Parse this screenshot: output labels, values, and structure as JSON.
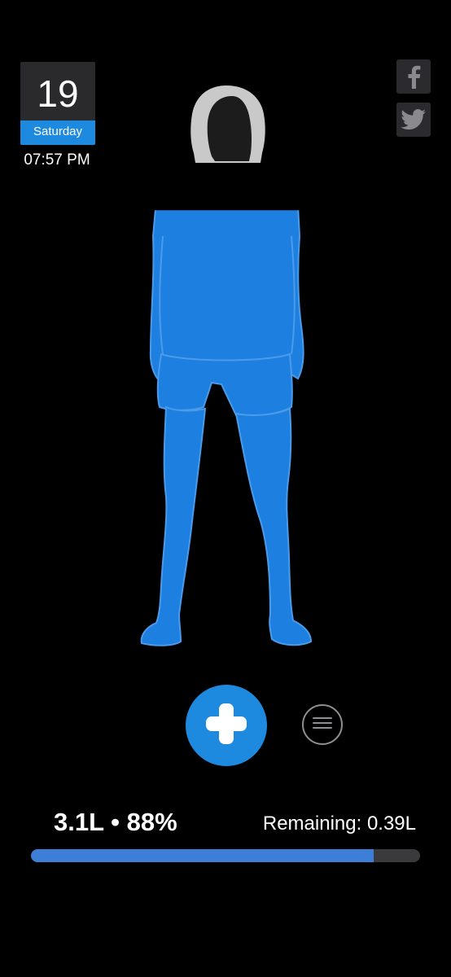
{
  "calendar": {
    "day": "19",
    "weekday": "Saturday",
    "time": "07:57 PM"
  },
  "social": {
    "facebook_icon": "facebook-icon",
    "twitter_icon": "twitter-icon"
  },
  "figure": {
    "fill_color": "#1d7fe0",
    "head_color": "#c9c9c9",
    "level_percent": 88
  },
  "actions": {
    "add_icon": "plus-icon",
    "menu_icon": "menu-lines-icon"
  },
  "stats": {
    "amount": "3.1L",
    "separator": "•",
    "percent": "88%",
    "remaining": "Remaining: 0.39L",
    "progress_fraction": 0.88
  },
  "colors": {
    "accent": "#1d8ae0",
    "progress": "#3d7fd6",
    "track": "#3a3a3c",
    "background": "#000000"
  }
}
